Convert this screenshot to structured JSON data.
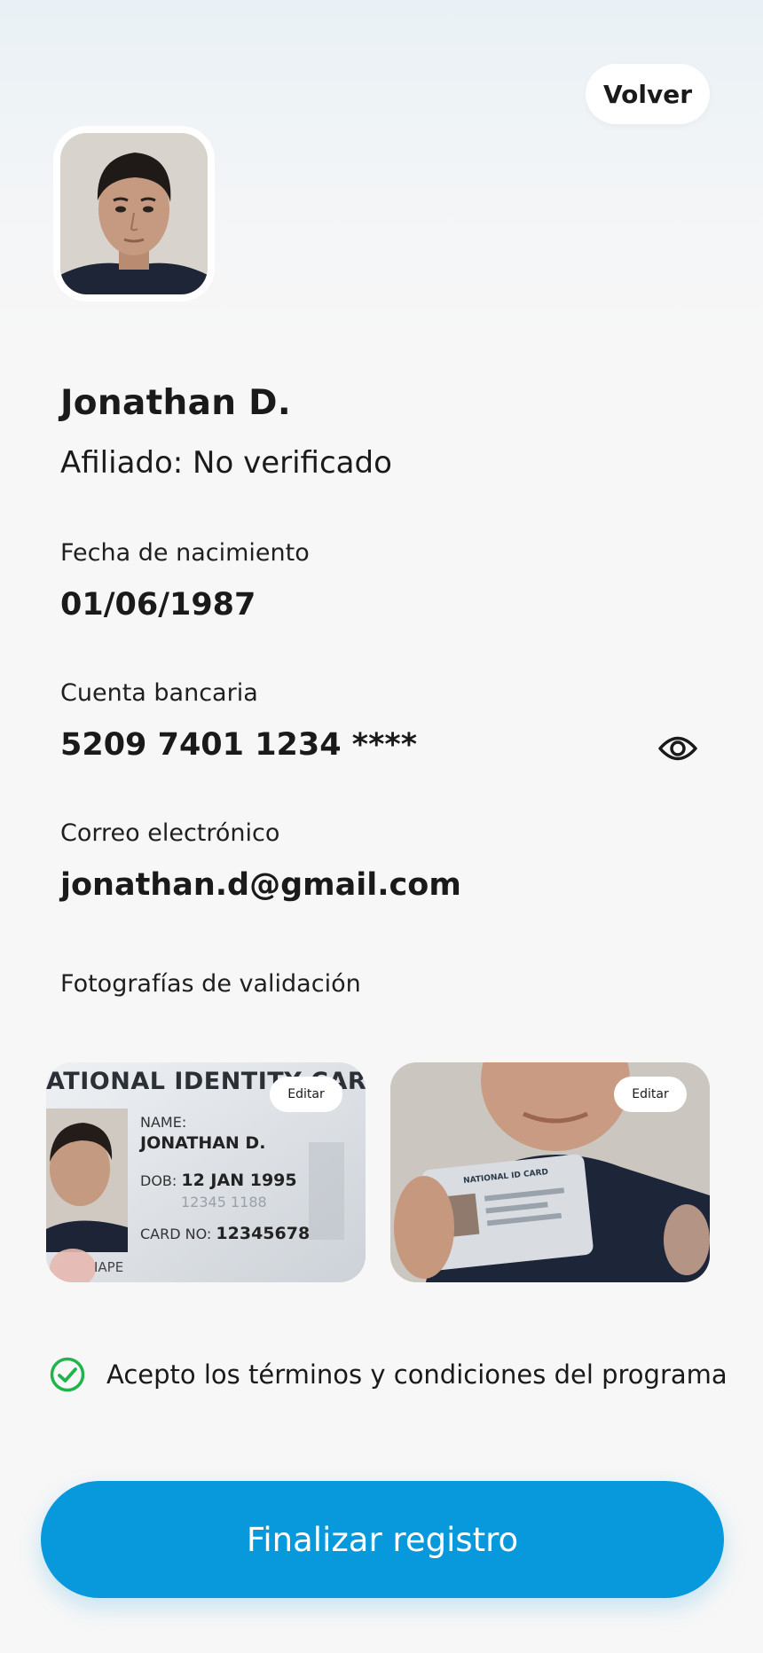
{
  "header": {
    "back_label": "Volver"
  },
  "profile": {
    "name": "Jonathan D.",
    "status": "Afiliado: No verificado"
  },
  "fields": {
    "birth": {
      "label": "Fecha de nacimiento",
      "value": "01/06/1987"
    },
    "bank": {
      "label": "Cuenta bancaria",
      "value": "5209 7401 1234 ****",
      "icon": "eye-icon"
    },
    "email": {
      "label": "Correo electrónico",
      "value": "jonathan.d@gmail.com"
    }
  },
  "photos": {
    "section_label": "Fotografías de validación",
    "cards": [
      {
        "edit_label": "Editar",
        "id_card": {
          "header": "ATIONAL IDENTITY CARD",
          "name_label": "NAME:",
          "name_value": "JONATHAN D.",
          "dob_label": "DOB:",
          "dob_value": "12 JAN 1995",
          "number_faded": "12345 1188",
          "card_label": "CARD NO:",
          "card_value": "12345678",
          "footer_text": "IAPE"
        }
      },
      {
        "edit_label": "Editar",
        "id_card": {
          "header": "NATIONAL ID CARD"
        }
      }
    ]
  },
  "terms": {
    "label": "Acepto los términos y condiciones del programa",
    "checked": true,
    "icon": "check-circle-icon"
  },
  "cta": {
    "label": "Finalizar registro"
  },
  "colors": {
    "primary": "#0899DD",
    "check": "#22B34A",
    "text": "#1A1A1A",
    "background": "#F7F7F7"
  }
}
